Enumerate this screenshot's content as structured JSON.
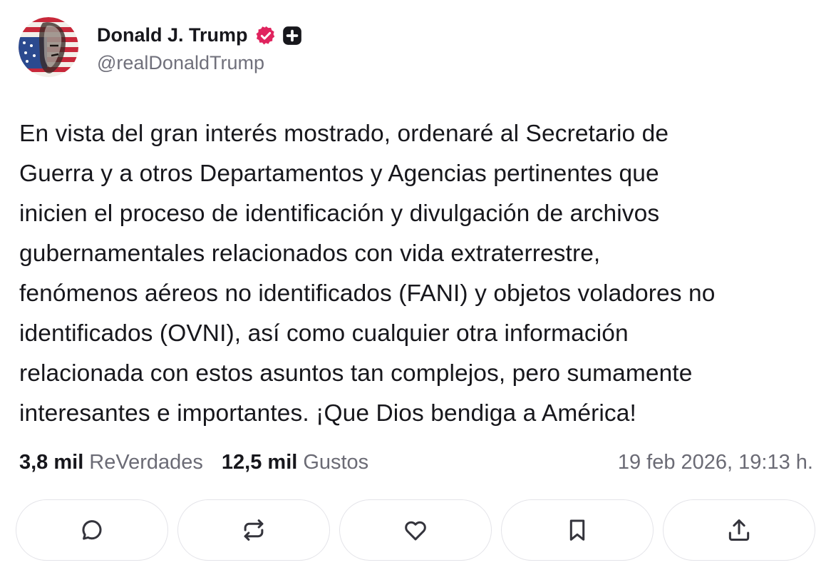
{
  "author": {
    "display_name": "Donald J. Trump",
    "handle": "@realDonaldTrump",
    "avatar_icon": "avatar-flag-portrait",
    "verified_icon": "verified-badge-icon",
    "plus_icon": "plus-badge-icon",
    "verified_color": "#e0245e"
  },
  "post": {
    "lines": [
      "En vista del gran interés mostrado, ordenaré al Secretario de",
      "Guerra y a otros Departamentos y Agencias pertinentes que",
      "inicien el proceso de identificación y divulgación de archivos",
      "gubernamentales relacionados con vida extraterrestre,",
      "fenómenos aéreos no identificados (FANI) y objetos voladores no",
      "identificados (OVNI), así como cualquier otra información",
      "relacionada con estos asuntos tan complejos, pero sumamente",
      "interesantes e importantes. ¡Que Dios bendiga a América!"
    ]
  },
  "stats": {
    "reposts_count": "3,8 mil",
    "reposts_label": "ReVerdades",
    "likes_count": "12,5 mil",
    "likes_label": "Gustos",
    "timestamp": "19 feb 2026, 19:13 h."
  },
  "actions": [
    {
      "icon": "reply-icon"
    },
    {
      "icon": "repost-icon"
    },
    {
      "icon": "heart-icon"
    },
    {
      "icon": "bookmark-icon"
    },
    {
      "icon": "share-icon"
    }
  ]
}
